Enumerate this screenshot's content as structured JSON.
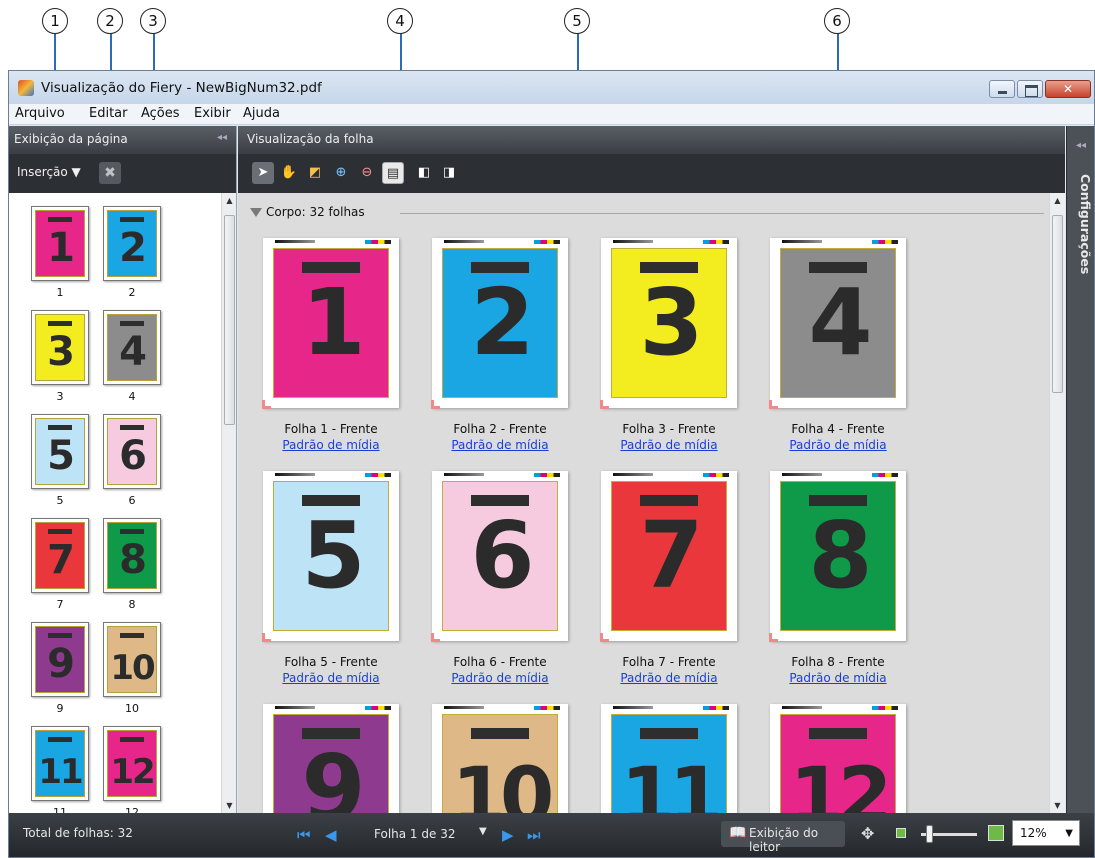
{
  "callouts": [
    "1",
    "2",
    "3",
    "4",
    "5",
    "6"
  ],
  "window": {
    "title": "Visualização do Fiery - NewBigNum32.pdf"
  },
  "menu": [
    "Arquivo",
    "Editar",
    "Ações",
    "Exibir",
    "Ajuda"
  ],
  "left_panel": {
    "title": "Exibição da página",
    "insert_label": "Inserção ▼",
    "thumbnails": [
      {
        "num": "1",
        "label": "1",
        "color": "#e7268a"
      },
      {
        "num": "2",
        "label": "2",
        "color": "#1aa6e2"
      },
      {
        "num": "3",
        "label": "3",
        "color": "#f3ec1e"
      },
      {
        "num": "4",
        "label": "4",
        "color": "#8c8c8c"
      },
      {
        "num": "5",
        "label": "5",
        "color": "#bde3f7"
      },
      {
        "num": "6",
        "label": "6",
        "color": "#f6cbe0"
      },
      {
        "num": "7",
        "label": "7",
        "color": "#e9373c"
      },
      {
        "num": "8",
        "label": "8",
        "color": "#0f9a4a"
      },
      {
        "num": "9",
        "label": "9",
        "color": "#8e3b8f"
      },
      {
        "num": "10",
        "label": "10",
        "color": "#deb886"
      },
      {
        "num": "11",
        "label": "11",
        "color": "#1aa6e2"
      },
      {
        "num": "12",
        "label": "12",
        "color": "#e7268a"
      }
    ]
  },
  "center_panel": {
    "title": "Visualização da folha",
    "section_label": "Corpo: 32 folhas",
    "sheets": [
      {
        "num": "1",
        "caption": "Folha 1 - Frente",
        "link": "Padrão de mídia",
        "color": "#e7268a"
      },
      {
        "num": "2",
        "caption": "Folha 2 - Frente",
        "link": "Padrão de mídia",
        "color": "#1aa6e2"
      },
      {
        "num": "3",
        "caption": "Folha 3 - Frente",
        "link": "Padrão de mídia",
        "color": "#f3ec1e"
      },
      {
        "num": "4",
        "caption": "Folha 4 - Frente",
        "link": "Padrão de mídia",
        "color": "#8c8c8c"
      },
      {
        "num": "5",
        "caption": "Folha 5 - Frente",
        "link": "Padrão de mídia",
        "color": "#bde3f7"
      },
      {
        "num": "6",
        "caption": "Folha 6 - Frente",
        "link": "Padrão de mídia",
        "color": "#f6cbe0"
      },
      {
        "num": "7",
        "caption": "Folha 7 - Frente",
        "link": "Padrão de mídia",
        "color": "#e9373c"
      },
      {
        "num": "8",
        "caption": "Folha 8 - Frente",
        "link": "Padrão de mídia",
        "color": "#0f9a4a"
      },
      {
        "num": "9",
        "caption": "",
        "link": "",
        "color": "#8e3b8f"
      },
      {
        "num": "10",
        "caption": "",
        "link": "",
        "color": "#deb886"
      },
      {
        "num": "11",
        "caption": "",
        "link": "",
        "color": "#1aa6e2"
      },
      {
        "num": "12",
        "caption": "",
        "link": "",
        "color": "#e7268a"
      }
    ]
  },
  "right_panel": {
    "label": "Configurações"
  },
  "status": {
    "total": "Total de folhas: 32",
    "page": "Folha 1 de 32",
    "reader_view": "Exibição do leitor",
    "zoom": "12%"
  },
  "icons": {
    "delete": "delete-x-icon",
    "tools": [
      "select-arrow-icon",
      "hand-pan-icon",
      "trim-box-icon",
      "zoom-in-icon",
      "zoom-out-icon",
      "page-view-icon",
      "insert-page-icon",
      "remove-page-icon"
    ]
  }
}
